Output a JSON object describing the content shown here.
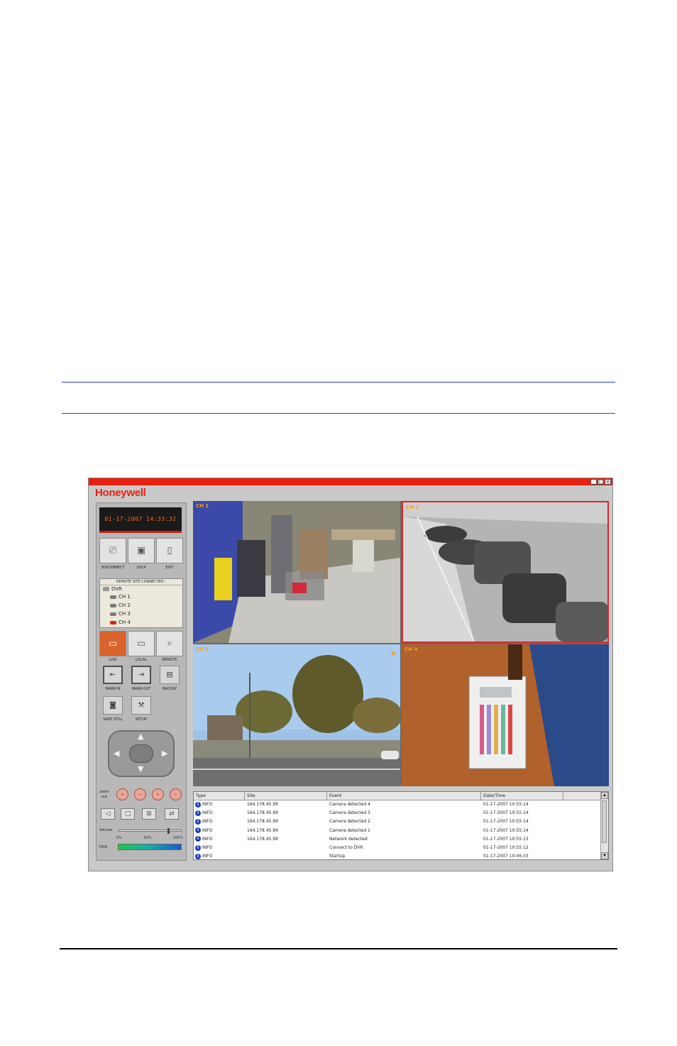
{
  "window": {
    "brand": "Honeywell",
    "controls": {
      "minimize": "_",
      "maximize": "□",
      "close": "×"
    },
    "accent_color": "#e8200f"
  },
  "panel": {
    "clock": "01-17-2007 14:33:32",
    "top_buttons": [
      {
        "label": "DISCONNECT",
        "icon": "disconnect-icon"
      },
      {
        "label": "LOCK",
        "icon": "lock-icon"
      },
      {
        "label": "EXIT",
        "icon": "exit-icon"
      }
    ],
    "tree": {
      "header": "REMOTE SITE CONNECTED :",
      "root": "DVR",
      "channels": [
        "CH 1",
        "CH 2",
        "CH 3",
        "CH 4"
      ]
    },
    "mode_buttons": [
      {
        "label": "LIVE",
        "icon": "live-monitor-icon",
        "selected": true
      },
      {
        "label": "LOCAL",
        "icon": "local-playback-icon",
        "selected": false
      },
      {
        "label": "REMOTE",
        "icon": "remote-search-icon",
        "selected": false
      }
    ],
    "action_buttons": [
      {
        "label": "MARK-IN",
        "icon": "mark-in-icon"
      },
      {
        "label": "MARK-OUT",
        "icon": "mark-out-icon"
      },
      {
        "label": "BACKUP",
        "icon": "backup-icon"
      },
      {
        "label": "SAVE STILL",
        "icon": "camera-icon"
      },
      {
        "label": "SETUP",
        "icon": "setup-tools-icon"
      }
    ],
    "focus_label": "zoom out",
    "volume_label": "Volume",
    "volume_level": 0.8,
    "volume_ticks": [
      "0%",
      "50%",
      "100%"
    ],
    "hdd_label": "HDD"
  },
  "cameras": [
    {
      "label": "CH 1"
    },
    {
      "label": "CH 2"
    },
    {
      "label": "CH 3"
    },
    {
      "label": "CH 4"
    }
  ],
  "log": {
    "columns": [
      "Type",
      "Site",
      "Event",
      "Date/Time"
    ],
    "rows": [
      {
        "type": "INFO",
        "site": "164.178.45.99",
        "event": "Camera detected 4",
        "datetime": "01-17-2007 10:55:14"
      },
      {
        "type": "INFO",
        "site": "164.178.45.99",
        "event": "Camera detected 3",
        "datetime": "01-17-2007 10:55:14"
      },
      {
        "type": "INFO",
        "site": "164.178.45.99",
        "event": "Camera detected 2",
        "datetime": "01-17-2007 10:55:14"
      },
      {
        "type": "INFO",
        "site": "164.178.45.99",
        "event": "Camera detected 1",
        "datetime": "01-17-2007 10:55:14"
      },
      {
        "type": "INFO",
        "site": "164.178.45.99",
        "event": "Network detected",
        "datetime": "01-17-2007 10:55:13"
      },
      {
        "type": "INFO",
        "site": "",
        "event": "Connect to DVR",
        "datetime": "01-17-2007 10:55:12"
      },
      {
        "type": "INFO",
        "site": "",
        "event": "Startup",
        "datetime": "01-17-2007 10:46:33"
      }
    ]
  }
}
